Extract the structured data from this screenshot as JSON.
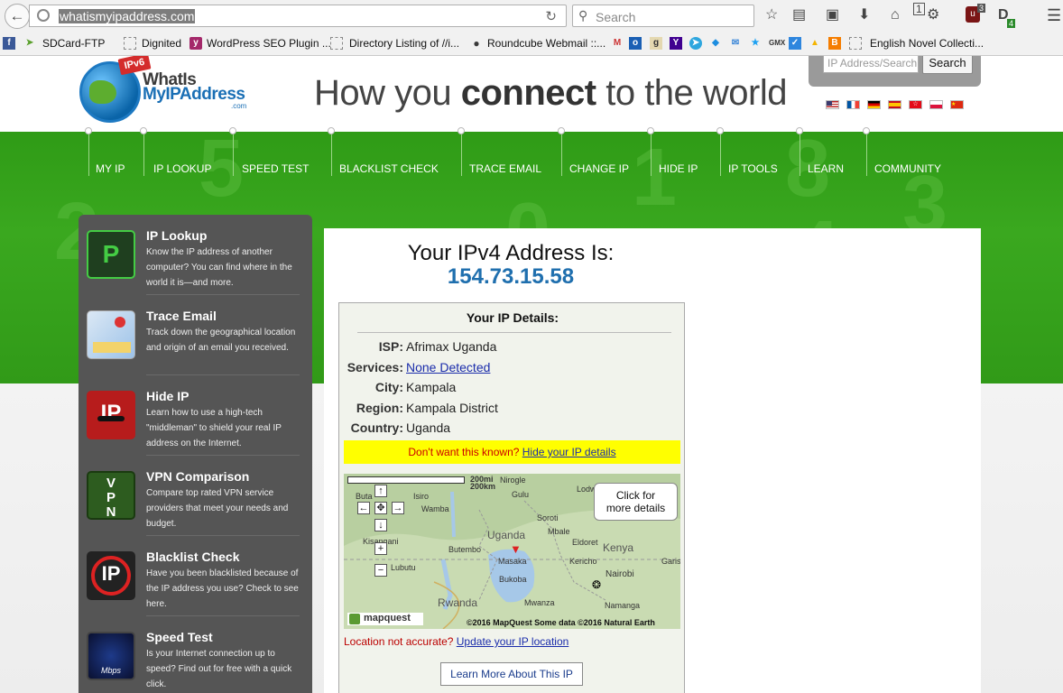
{
  "browser": {
    "url": "whatismyipaddress.com",
    "search_placeholder": "Search",
    "ublock_badge": "3",
    "toolbar_count": "1",
    "ext_badge": "4",
    "bookmarks": [
      {
        "label": "SDCard-FTP",
        "icon": "ftp-icon",
        "color": "#5aa02c"
      },
      {
        "label": "Dignited",
        "icon": "page-icon",
        "color": "#999999"
      },
      {
        "label": "WordPress SEO Plugin ...",
        "icon": "yoast-icon",
        "color": "#a4286a"
      },
      {
        "label": "Directory Listing of //i...",
        "icon": "page-icon",
        "color": "#999999"
      },
      {
        "label": "Roundcube Webmail ::...",
        "icon": "roundcube-icon",
        "color": "#3a3a3a"
      },
      {
        "label": "English Novel Collecti...",
        "icon": "page-icon",
        "color": "#999999"
      }
    ]
  },
  "header": {
    "logo_badge": "IPv6",
    "logo_line1": "WhatIs",
    "logo_line2": "MyIPAddress",
    "logo_line3": ".com",
    "tagline_pre": "How you ",
    "tagline_bold": "connect",
    "tagline_post": " to the world",
    "search_placeholder": "IP Address/Search",
    "search_button": "Search"
  },
  "nav": [
    "MY IP",
    "IP LOOKUP",
    "SPEED TEST",
    "BLACKLIST CHECK",
    "TRACE EMAIL",
    "CHANGE IP",
    "HIDE IP",
    "IP TOOLS",
    "LEARN",
    "COMMUNITY"
  ],
  "sidebar": [
    {
      "title": "IP Lookup",
      "desc": "Know the IP address of another computer? You can find where in the world it is—and more.",
      "icon": "ip-lookup-icon"
    },
    {
      "title": "Trace Email",
      "desc": "Track down the geographical location and origin of an email you received.",
      "icon": "trace-email-icon"
    },
    {
      "title": "Hide IP",
      "desc": "Learn how to use a high-tech \"middleman\" to shield your real IP address on the Internet.",
      "icon": "hide-ip-icon"
    },
    {
      "title": "VPN Comparison",
      "desc": "Compare top rated VPN service providers that meet your needs and budget.",
      "icon": "vpn-icon"
    },
    {
      "title": "Blacklist Check",
      "desc": "Have you been blacklisted because of the IP address you use? Check to see here.",
      "icon": "blacklist-icon"
    },
    {
      "title": "Speed Test",
      "desc": "Is your Internet connection up to speed? Find out for free with a quick click.",
      "icon": "speed-test-icon"
    }
  ],
  "main": {
    "heading": "Your IPv4 Address Is:",
    "ip": "154.73.15.58",
    "details_title": "Your IP Details:",
    "details": [
      {
        "label": "ISP:",
        "value": "Afrimax Uganda",
        "link": false
      },
      {
        "label": "Services:",
        "value": "None Detected",
        "link": true
      },
      {
        "label": "City:",
        "value": "Kampala",
        "link": false
      },
      {
        "label": "Region:",
        "value": "Kampala District",
        "link": false
      },
      {
        "label": "Country:",
        "value": "Uganda",
        "link": false
      }
    ],
    "warning_text": "Don't want this known?",
    "warning_link": "Hide your IP details",
    "map_tooltip_l1": "Click for",
    "map_tooltip_l2": "more details",
    "map_scale_mi": "200mi",
    "map_scale_km": "200km",
    "map_labels": [
      "Nirogle",
      "Lodwar",
      "Buta",
      "Isiro",
      "Gulu",
      "Wamba",
      "Soroti",
      "Uganda",
      "Mbale",
      "Kisangani",
      "Butembo",
      "Eldoret",
      "Kenya",
      "Lubutu",
      "Masaka",
      "Kericho",
      "Nairobi",
      "Bukoba",
      "Garis",
      "Rwanda",
      "Mwanza",
      "Namanga"
    ],
    "map_logo": "mapquest",
    "map_copyright": "©2016 MapQuest Some data ©2016 Natural Earth",
    "location_q": "Location not accurate?",
    "location_link": "Update your IP location",
    "learn_more": "Learn More About This IP"
  },
  "colors": {
    "nav_green": "#3aa81f",
    "ip_blue": "#1f6fae",
    "sidebar_gray": "#555555",
    "warning_yellow": "#ffff00"
  }
}
